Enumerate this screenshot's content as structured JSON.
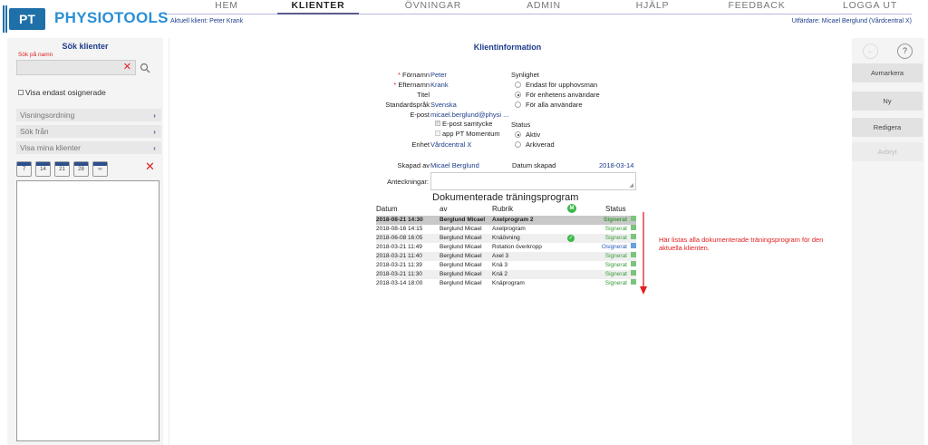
{
  "logo": {
    "badge": "PT",
    "name": "PHYSIOTOOLS"
  },
  "nav": [
    {
      "label": "HEM",
      "active": false
    },
    {
      "label": "KLIENTER",
      "active": true
    },
    {
      "label": "ÖVNINGAR",
      "active": false
    },
    {
      "label": "ADMIN",
      "active": false
    },
    {
      "label": "HJÄLP",
      "active": false
    },
    {
      "label": "FEEDBACK",
      "active": false
    },
    {
      "label": "LOGGA UT",
      "active": false
    }
  ],
  "subheader": {
    "current_client": "Aktuell klient: Peter Krank",
    "issuer": "Utfärdare: Micael Berglund (Vårdcentral X)"
  },
  "sidebar": {
    "title": "Sök klienter",
    "search_label": "Sök på namn",
    "search_value": "",
    "unsigned_only": "Visa endast osignerade",
    "sections": [
      "Visningsordning",
      "Sök från",
      "Visa mina klienter"
    ],
    "calendar_days": [
      "7",
      "14",
      "21",
      "28",
      "∞"
    ]
  },
  "client": {
    "title": "Klientinformation",
    "fields": {
      "firstname_label": "Förnamn",
      "firstname": "Peter",
      "lastname_label": "Efternamn",
      "lastname": "Krank",
      "title_label": "Titel",
      "language_label": "Standardspråk",
      "language": "Svenska",
      "email_label": "E-post",
      "email": "micael.berglund@physi ...",
      "email_consent": "E-post samtycke",
      "app_label": "app PT Momentum",
      "unit_label": "Enhet",
      "unit": "Vårdcentral X"
    },
    "visibility": {
      "label": "Synlighet",
      "options": [
        "Endast för upphovsman",
        "För enhetens användare",
        "För alla användare"
      ],
      "selected": 1
    },
    "status": {
      "label": "Status",
      "options": [
        "Aktiv",
        "Arkiverad"
      ],
      "selected": 0
    },
    "created_by_label": "Skapad av",
    "created_by": "Micael Berglund",
    "created_date_label": "Datum skapad",
    "created_date": "2018-03-14",
    "notes_label": "Anteckningar:"
  },
  "programs": {
    "title": "Dokumenterade träningsprogram",
    "headers": {
      "date": "Datum",
      "by": "av",
      "heading": "Rubrik",
      "m": "M",
      "status": "Status"
    },
    "rows": [
      {
        "date": "2018-08-21 14:30",
        "by": "Berglund Micael",
        "heading": "Axelprogram 2",
        "status": "Signerat",
        "status_type": "sig",
        "m": false
      },
      {
        "date": "2018-08-16 14:15",
        "by": "Berglund Micael",
        "heading": "Axelprogram",
        "status": "Signerat",
        "status_type": "sig",
        "m": false
      },
      {
        "date": "2018-06-08 16:05",
        "by": "Berglund Micael",
        "heading": "Knäövning",
        "status": "Signerat",
        "status_type": "sig",
        "m": true
      },
      {
        "date": "2018-03-21 11:49",
        "by": "Berglund Micael",
        "heading": "Rotation överkropp",
        "status": "Osignerat",
        "status_type": "osig",
        "m": false
      },
      {
        "date": "2018-03-21 11:40",
        "by": "Berglund Micael",
        "heading": "Axel 3",
        "status": "Signerat",
        "status_type": "sig",
        "m": false
      },
      {
        "date": "2018-03-21 11:39",
        "by": "Berglund Micael",
        "heading": "Knä 3",
        "status": "Signerat",
        "status_type": "sig",
        "m": false
      },
      {
        "date": "2018-03-21 11:30",
        "by": "Berglund Micael",
        "heading": "Knä 2",
        "status": "Signerat",
        "status_type": "sig",
        "m": false
      },
      {
        "date": "2018-03-14 18:00",
        "by": "Berglund Micael",
        "heading": "Knäprogram",
        "status": "Signerat",
        "status_type": "sig",
        "m": false
      }
    ]
  },
  "annotation": "Här listas alla dokumenterade träningsprogram för den aktuella klienten.",
  "actions": {
    "avmarkera": "Avmarkera",
    "ny": "Ny",
    "redigera": "Redigera",
    "avbryt": "Avbryt"
  },
  "colors": {
    "accent": "#1f6fa8",
    "link": "#1d3c8a",
    "signed": "#3a9c3a",
    "unsigned": "#2b5fb8",
    "annotation": "#e02020"
  }
}
